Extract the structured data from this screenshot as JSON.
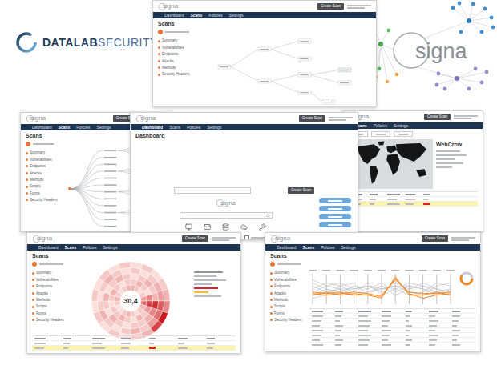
{
  "brand": {
    "name": "DATALAB",
    "suffix": "SECURITY"
  },
  "product": {
    "name": "signa"
  },
  "windows": [
    {
      "kind": "graph",
      "title": "Scans",
      "action": "Create Scan",
      "nav": [
        {
          "label": "Dashboard",
          "selected": false
        },
        {
          "label": "Scans",
          "selected": true
        },
        {
          "label": "Policies",
          "selected": false
        },
        {
          "label": "Settings",
          "selected": false
        }
      ],
      "sidebar": [
        "Summary",
        "Vulnerabilities",
        "Endpoints",
        "Attacks",
        "Methods",
        "Security Headers"
      ]
    },
    {
      "kind": "tree",
      "title": "Scans",
      "action": "Create Scan",
      "nav": [
        {
          "label": "Dashboard",
          "selected": false
        },
        {
          "label": "Scans",
          "selected": true
        },
        {
          "label": "Policies",
          "selected": false
        },
        {
          "label": "Settings",
          "selected": false
        }
      ],
      "sidebar": [
        "Summary",
        "Vulnerabilities",
        "Endpoints",
        "Attacks",
        "Methods",
        "Scripts",
        "Forms",
        "Security Headers"
      ]
    },
    {
      "kind": "map",
      "title": "WebCrow",
      "action": "Create Scan",
      "nav": [
        {
          "label": "Scans",
          "selected": true
        },
        {
          "label": "Policies",
          "selected": false
        },
        {
          "label": "Settings",
          "selected": false
        }
      ],
      "rows": [
        {
          "selected": false
        },
        {
          "selected": true
        }
      ]
    },
    {
      "kind": "dashboard",
      "title": "Dashboard",
      "action": "Create Scan",
      "button": "Create Scan",
      "nav": [
        {
          "label": "Dashboard",
          "selected": true
        },
        {
          "label": "Scans",
          "selected": false
        },
        {
          "label": "Policies",
          "selected": false
        },
        {
          "label": "Settings",
          "selected": false
        }
      ],
      "checks": [
        {
          "checked": true
        },
        {
          "checked": false
        },
        {
          "checked": false
        }
      ]
    },
    {
      "kind": "radial",
      "title": "Scans",
      "action": "Create Scan",
      "center": "30,4",
      "nav": [
        {
          "label": "Dashboard",
          "selected": false
        },
        {
          "label": "Scans",
          "selected": true
        },
        {
          "label": "Policies",
          "selected": false
        },
        {
          "label": "Settings",
          "selected": false
        }
      ],
      "sidebar": [
        "Summary",
        "Vulnerabilities",
        "Endpoints",
        "Attacks",
        "Methods",
        "Scripts",
        "Forms",
        "Security Headers"
      ],
      "rings": [
        [
          0.3,
          0.2,
          0.1,
          0.2,
          0.4,
          0.6,
          0.3,
          0.2,
          0.1,
          0.2,
          0.3,
          0.2,
          0.1,
          0.1,
          0.2,
          0.3,
          0.2,
          0.1,
          0.2,
          0.3
        ],
        [
          0.2,
          0.3,
          0.2,
          0.1,
          0.5,
          0.8,
          0.4,
          0.2,
          0.3,
          0.1,
          0.2,
          0.3,
          0.2,
          0.2,
          0.1,
          0.2,
          0.3,
          0.2,
          0.1,
          0.2
        ],
        [
          0.1,
          0.2,
          0.3,
          0.2,
          0.3,
          0.9,
          0.5,
          0.3,
          0.2,
          0.2,
          0.1,
          0.2,
          0.3,
          0.1,
          0.2,
          0.3,
          0.1,
          0.2,
          0.3,
          0.2
        ],
        [
          0.2,
          0.1,
          0.2,
          0.3,
          0.4,
          0.7,
          0.6,
          0.4,
          0.2,
          0.3,
          0.2,
          0.1,
          0.2,
          0.3,
          0.2,
          0.1,
          0.2,
          0.3,
          0.2,
          0.1
        ],
        [
          0.1,
          0.2,
          0.1,
          0.2,
          0.3,
          0.5,
          1.0,
          0.8,
          0.3,
          0.2,
          0.1,
          0.2,
          0.1,
          0.2,
          0.1,
          0.2,
          0.1,
          0.2,
          0.1,
          0.2
        ]
      ],
      "rows": [
        {
          "selected": false
        },
        {
          "selected": true
        }
      ]
    },
    {
      "kind": "parallel",
      "title": "Scans",
      "action": "Create Scan",
      "nav": [
        {
          "label": "Dashboard",
          "selected": false
        },
        {
          "label": "Scans",
          "selected": true
        },
        {
          "label": "Policies",
          "selected": false
        },
        {
          "label": "Settings",
          "selected": false
        }
      ],
      "sidebar": [
        "Summary",
        "Vulnerabilities",
        "Endpoints",
        "Attacks",
        "Methods",
        "Scripts",
        "Forms",
        "Security Headers"
      ],
      "lines": [
        {
          "values": [
            0.8,
            0.6,
            0.7,
            0.5,
            0.6,
            0.4,
            0.7,
            0.5,
            0.6,
            0.5,
            0.4
          ],
          "highlighted": false
        },
        {
          "values": [
            0.3,
            0.5,
            0.4,
            0.6,
            0.5,
            0.7,
            0.4,
            0.6,
            0.5,
            0.3,
            0.5
          ],
          "highlighted": false
        },
        {
          "values": [
            0.6,
            0.4,
            0.5,
            0.3,
            0.4,
            0.5,
            0.6,
            0.4,
            0.3,
            0.6,
            0.7
          ],
          "highlighted": false
        },
        {
          "values": [
            0.5,
            0.7,
            0.6,
            0.7,
            0.3,
            0.6,
            0.5,
            0.7,
            0.6,
            0.4,
            0.3
          ],
          "highlighted": false
        },
        {
          "values": [
            0.2,
            0.3,
            0.6,
            0.4,
            0.7,
            0.3,
            0.5,
            0.3,
            0.4,
            0.7,
            0.6
          ],
          "highlighted": false
        },
        {
          "values": [
            0.7,
            0.5,
            0.3,
            0.6,
            0.4,
            0.6,
            0.3,
            0.5,
            0.7,
            0.5,
            0.4
          ],
          "highlighted": false
        },
        {
          "values": [
            0.4,
            0.6,
            0.5,
            0.5,
            0.6,
            0.5,
            0.6,
            0.6,
            0.5,
            0.4,
            0.5
          ],
          "highlighted": false
        },
        {
          "values": [
            0.3,
            0.4,
            0.3,
            0.35,
            0.3,
            0.2,
            0.9,
            0.3,
            0.3,
            0.4,
            0.3
          ],
          "highlighted": true
        },
        {
          "values": [
            0.35,
            0.3,
            0.35,
            0.4,
            0.35,
            0.25,
            0.85,
            0.35,
            0.2,
            0.3,
            0.35
          ],
          "highlighted": true
        },
        {
          "values": [
            0.4,
            0.35,
            0.4,
            0.3,
            0.3,
            0.3,
            0.8,
            0.4,
            0.35,
            0.35,
            0.4
          ],
          "highlighted": true
        }
      ],
      "rows": [
        {
          "selected": false
        },
        {
          "selected": false
        },
        {
          "selected": false
        },
        {
          "selected": false
        },
        {
          "selected": false
        },
        {
          "selected": false
        },
        {
          "selected": false
        }
      ]
    }
  ]
}
